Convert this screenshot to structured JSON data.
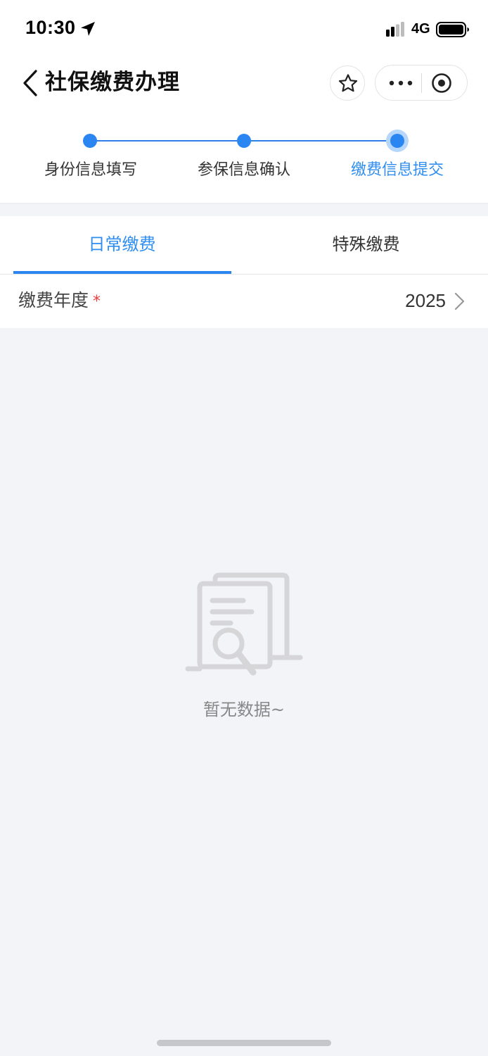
{
  "status_bar": {
    "time": "10:30",
    "network": "4G",
    "icons": [
      "location-arrow-icon",
      "signal-icon",
      "battery-icon"
    ]
  },
  "nav": {
    "title": "社保缴费办理",
    "icons": [
      "back-icon",
      "star-icon",
      "more-icon",
      "target-icon"
    ]
  },
  "steps": [
    {
      "label": "身份信息填写",
      "state": "done"
    },
    {
      "label": "参保信息确认",
      "state": "done"
    },
    {
      "label": "缴费信息提交",
      "state": "current"
    }
  ],
  "tabs": [
    {
      "label": "日常缴费",
      "active": true
    },
    {
      "label": "特殊缴费",
      "active": false
    }
  ],
  "form": {
    "year_label": "缴费年度",
    "required_mark": "*",
    "year_value": "2025"
  },
  "empty_state": {
    "text": "暂无数据~"
  },
  "colors": {
    "accent": "#2b86f2",
    "required": "#ee3b3b",
    "background": "#f3f4f8"
  }
}
